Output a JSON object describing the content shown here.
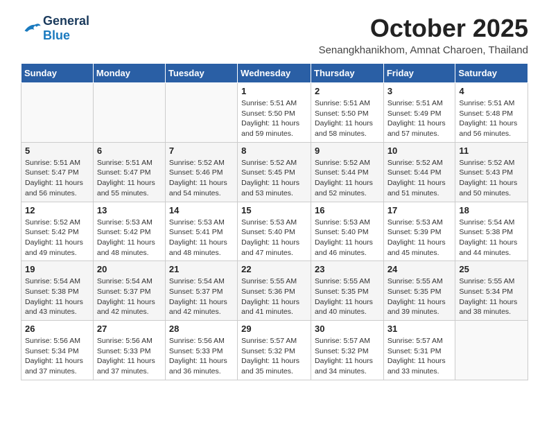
{
  "header": {
    "logo_general": "General",
    "logo_blue": "Blue",
    "month": "October 2025",
    "location": "Senangkhanikhom, Amnat Charoen, Thailand"
  },
  "weekdays": [
    "Sunday",
    "Monday",
    "Tuesday",
    "Wednesday",
    "Thursday",
    "Friday",
    "Saturday"
  ],
  "weeks": [
    [
      {
        "day": "",
        "sunrise": "",
        "sunset": "",
        "daylight": ""
      },
      {
        "day": "",
        "sunrise": "",
        "sunset": "",
        "daylight": ""
      },
      {
        "day": "",
        "sunrise": "",
        "sunset": "",
        "daylight": ""
      },
      {
        "day": "1",
        "sunrise": "5:51 AM",
        "sunset": "5:50 PM",
        "daylight": "11 hours and 59 minutes."
      },
      {
        "day": "2",
        "sunrise": "5:51 AM",
        "sunset": "5:50 PM",
        "daylight": "11 hours and 58 minutes."
      },
      {
        "day": "3",
        "sunrise": "5:51 AM",
        "sunset": "5:49 PM",
        "daylight": "11 hours and 57 minutes."
      },
      {
        "day": "4",
        "sunrise": "5:51 AM",
        "sunset": "5:48 PM",
        "daylight": "11 hours and 56 minutes."
      }
    ],
    [
      {
        "day": "5",
        "sunrise": "5:51 AM",
        "sunset": "5:47 PM",
        "daylight": "11 hours and 56 minutes."
      },
      {
        "day": "6",
        "sunrise": "5:51 AM",
        "sunset": "5:47 PM",
        "daylight": "11 hours and 55 minutes."
      },
      {
        "day": "7",
        "sunrise": "5:52 AM",
        "sunset": "5:46 PM",
        "daylight": "11 hours and 54 minutes."
      },
      {
        "day": "8",
        "sunrise": "5:52 AM",
        "sunset": "5:45 PM",
        "daylight": "11 hours and 53 minutes."
      },
      {
        "day": "9",
        "sunrise": "5:52 AM",
        "sunset": "5:44 PM",
        "daylight": "11 hours and 52 minutes."
      },
      {
        "day": "10",
        "sunrise": "5:52 AM",
        "sunset": "5:44 PM",
        "daylight": "11 hours and 51 minutes."
      },
      {
        "day": "11",
        "sunrise": "5:52 AM",
        "sunset": "5:43 PM",
        "daylight": "11 hours and 50 minutes."
      }
    ],
    [
      {
        "day": "12",
        "sunrise": "5:52 AM",
        "sunset": "5:42 PM",
        "daylight": "11 hours and 49 minutes."
      },
      {
        "day": "13",
        "sunrise": "5:53 AM",
        "sunset": "5:42 PM",
        "daylight": "11 hours and 48 minutes."
      },
      {
        "day": "14",
        "sunrise": "5:53 AM",
        "sunset": "5:41 PM",
        "daylight": "11 hours and 48 minutes."
      },
      {
        "day": "15",
        "sunrise": "5:53 AM",
        "sunset": "5:40 PM",
        "daylight": "11 hours and 47 minutes."
      },
      {
        "day": "16",
        "sunrise": "5:53 AM",
        "sunset": "5:40 PM",
        "daylight": "11 hours and 46 minutes."
      },
      {
        "day": "17",
        "sunrise": "5:53 AM",
        "sunset": "5:39 PM",
        "daylight": "11 hours and 45 minutes."
      },
      {
        "day": "18",
        "sunrise": "5:54 AM",
        "sunset": "5:38 PM",
        "daylight": "11 hours and 44 minutes."
      }
    ],
    [
      {
        "day": "19",
        "sunrise": "5:54 AM",
        "sunset": "5:38 PM",
        "daylight": "11 hours and 43 minutes."
      },
      {
        "day": "20",
        "sunrise": "5:54 AM",
        "sunset": "5:37 PM",
        "daylight": "11 hours and 42 minutes."
      },
      {
        "day": "21",
        "sunrise": "5:54 AM",
        "sunset": "5:37 PM",
        "daylight": "11 hours and 42 minutes."
      },
      {
        "day": "22",
        "sunrise": "5:55 AM",
        "sunset": "5:36 PM",
        "daylight": "11 hours and 41 minutes."
      },
      {
        "day": "23",
        "sunrise": "5:55 AM",
        "sunset": "5:35 PM",
        "daylight": "11 hours and 40 minutes."
      },
      {
        "day": "24",
        "sunrise": "5:55 AM",
        "sunset": "5:35 PM",
        "daylight": "11 hours and 39 minutes."
      },
      {
        "day": "25",
        "sunrise": "5:55 AM",
        "sunset": "5:34 PM",
        "daylight": "11 hours and 38 minutes."
      }
    ],
    [
      {
        "day": "26",
        "sunrise": "5:56 AM",
        "sunset": "5:34 PM",
        "daylight": "11 hours and 37 minutes."
      },
      {
        "day": "27",
        "sunrise": "5:56 AM",
        "sunset": "5:33 PM",
        "daylight": "11 hours and 37 minutes."
      },
      {
        "day": "28",
        "sunrise": "5:56 AM",
        "sunset": "5:33 PM",
        "daylight": "11 hours and 36 minutes."
      },
      {
        "day": "29",
        "sunrise": "5:57 AM",
        "sunset": "5:32 PM",
        "daylight": "11 hours and 35 minutes."
      },
      {
        "day": "30",
        "sunrise": "5:57 AM",
        "sunset": "5:32 PM",
        "daylight": "11 hours and 34 minutes."
      },
      {
        "day": "31",
        "sunrise": "5:57 AM",
        "sunset": "5:31 PM",
        "daylight": "11 hours and 33 minutes."
      },
      {
        "day": "",
        "sunrise": "",
        "sunset": "",
        "daylight": ""
      }
    ]
  ]
}
